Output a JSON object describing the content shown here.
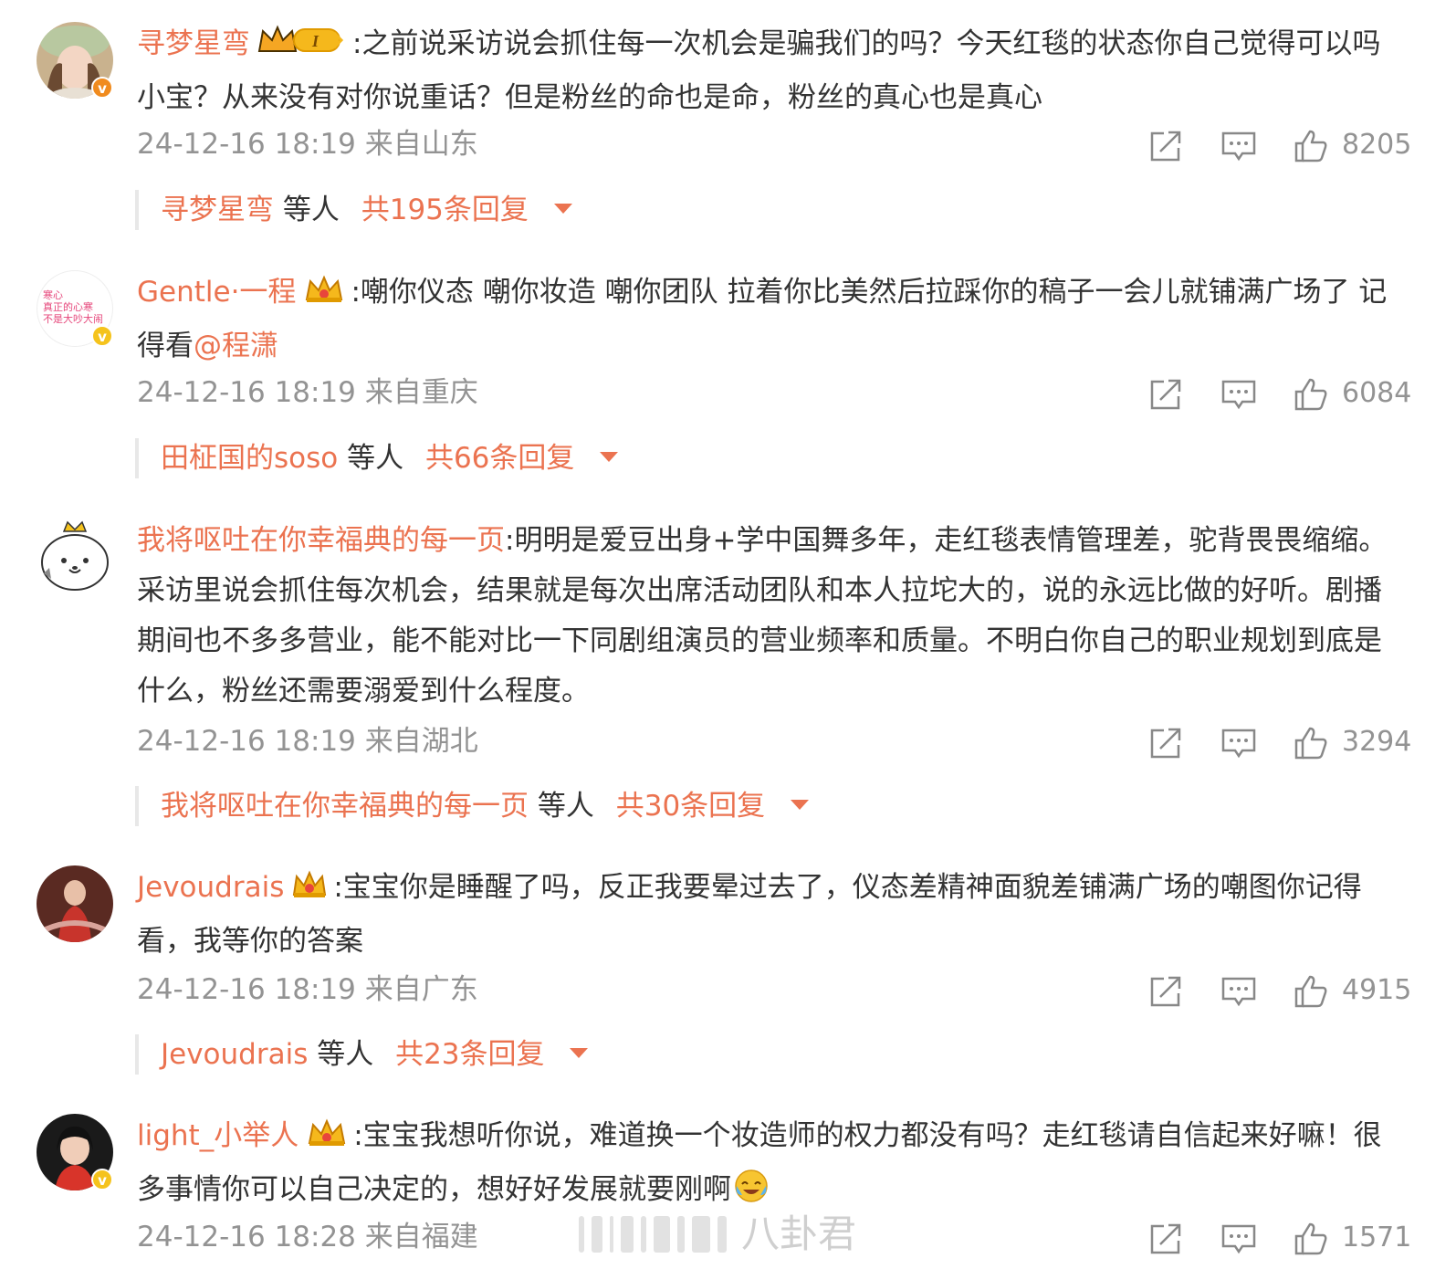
{
  "comments": [
    {
      "username": "寻梦星弯",
      "badge": "crown-level-1",
      "badge_level": "I",
      "verified": "orange",
      "text": ":之前说采访说会抓住每一次机会是骗我们的吗？今天红毯的状态你自己觉得可以吗小宝？从来没有对你说重话？但是粉丝的命也是命，粉丝的真心也是真心",
      "mention": "",
      "time": "24-12-16 18:19 来自山东",
      "likes": "8205",
      "reply_user": "寻梦星弯",
      "reply_mid": "等人",
      "reply_count": "共195条回复"
    },
    {
      "username": "Gentle·一程",
      "badge": "crown",
      "verified": "gold",
      "avatar_text": "寒心 真正的心寒 不是大吵大闹",
      "text": ":嘲你仪态 嘲你妆造 嘲你团队 拉着你比美然后拉踩你的稿子一会儿就铺满广场了 记得看",
      "mention": "@程潇",
      "time": "24-12-16 18:19 来自重庆",
      "likes": "6084",
      "reply_user": "田柾国的soso",
      "reply_mid": "等人",
      "reply_count": "共66条回复"
    },
    {
      "username": "我将呕吐在你幸福典的每一页",
      "badge": "",
      "verified": "",
      "text": ":明明是爱豆出身+学中国舞多年，走红毯表情管理差，驼背畏畏缩缩。采访里说会抓住每次机会，结果就是每次出席活动团队和本人拉坨大的，说的永远比做的好听。剧播期间也不多多营业，能不能对比一下同剧组演员的营业频率和质量。不明白你自己的职业规划到底是什么，粉丝还需要溺爱到什么程度。",
      "mention": "",
      "time": "24-12-16 18:19 来自湖北",
      "likes": "3294",
      "reply_user": "我将呕吐在你幸福典的每一页",
      "reply_mid": "等人",
      "reply_count": "共30条回复"
    },
    {
      "username": "Jevoudrais",
      "badge": "crown",
      "verified": "",
      "text": ":宝宝你是睡醒了吗，反正我要晕过去了，仪态差精神面貌差铺满广场的嘲图你记得看，我等你的答案",
      "mention": "",
      "time": "24-12-16 18:19 来自广东",
      "likes": "4915",
      "reply_user": "Jevoudrais",
      "reply_mid": "等人",
      "reply_count": "共23条回复"
    },
    {
      "username": "light_小举人",
      "badge": "crown",
      "verified": "gold",
      "text": ":宝宝我想听你说，难道换一个妆造师的权力都没有吗？走红毯请自信起来好嘛！很多事情你可以自己决定的，想好好发展就要刚啊",
      "mention": "",
      "time": "24-12-16 18:28 来自福建",
      "likes": "1571",
      "reply_user": "",
      "reply_mid": "",
      "reply_count": ""
    }
  ],
  "watermark": "八卦君",
  "colors": {
    "accent": "#eb7350",
    "meta": "#939393",
    "text": "#333333"
  }
}
